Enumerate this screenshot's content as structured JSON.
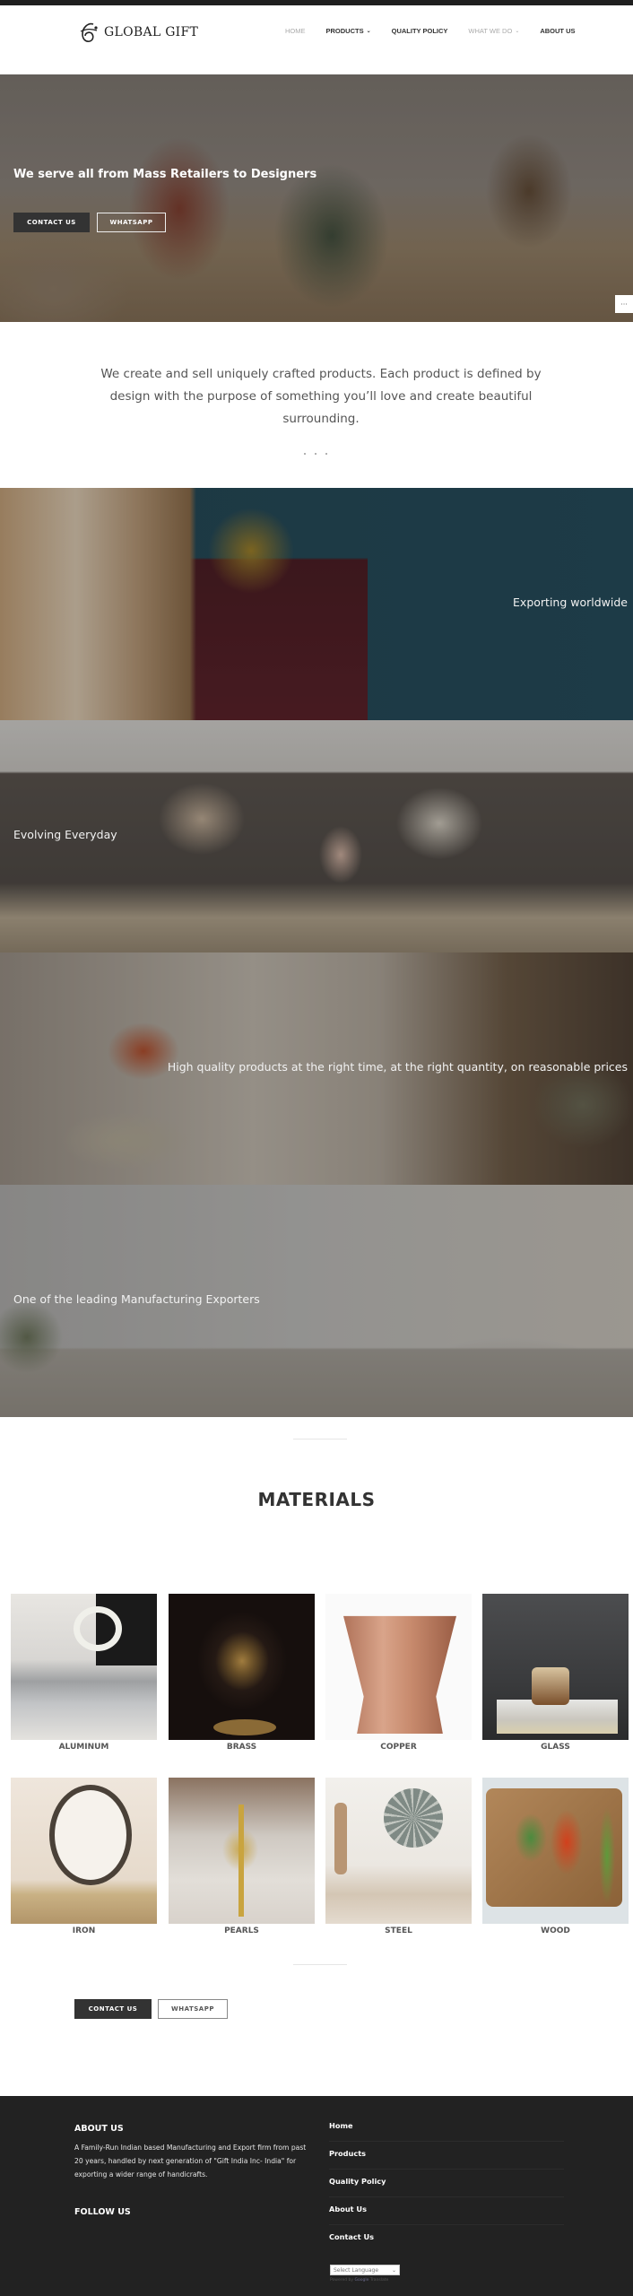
{
  "header": {
    "logo_text": "GLOBAL GIFT",
    "nav": [
      {
        "label": "HOME",
        "dropdown": false,
        "muted": true
      },
      {
        "label": "PRODUCTS",
        "dropdown": true,
        "muted": false
      },
      {
        "label": "QUALITY POLICY",
        "dropdown": false,
        "muted": false
      },
      {
        "label": "WHAT WE DO",
        "dropdown": true,
        "muted": true
      },
      {
        "label": "ABOUT US",
        "dropdown": false,
        "muted": false
      }
    ]
  },
  "hero": {
    "title": "We serve all from Mass Retailers to Designers",
    "contact_label": "CONTACT US",
    "whatsapp_label": "WHATSAPP",
    "more_label": "···"
  },
  "intro": {
    "text": "We create and sell uniquely crafted products. Each product is defined by design with the purpose of something you’ll love and create beautiful surrounding."
  },
  "banners": [
    {
      "text": "Exporting worldwide",
      "align": "right"
    },
    {
      "text": "Evolving Everyday",
      "align": "left"
    },
    {
      "text": "High quality products at the right time, at the right quantity, on reasonable prices",
      "align": "right"
    },
    {
      "text": "One of the leading Manufacturing Exporters",
      "align": "left"
    }
  ],
  "materials": {
    "title": "MATERIALS",
    "items": [
      {
        "label": "ALUMINUM"
      },
      {
        "label": "BRASS"
      },
      {
        "label": "COPPER"
      },
      {
        "label": "GLASS"
      },
      {
        "label": "IRON"
      },
      {
        "label": "PEARLS"
      },
      {
        "label": "STEEL"
      },
      {
        "label": "WOOD"
      }
    ]
  },
  "cta": {
    "contact_label": "CONTACT US",
    "whatsapp_label": "WHATSAPP"
  },
  "footer": {
    "about_heading": "ABOUT US",
    "about_text": "A Family-Run Indian based Manufacturing and Export firm from past 20 years, handled by next generation of \"Gift India Inc- India\" for exporting a wider range of handicrafts.",
    "follow_heading": "FOLLOW US",
    "links": [
      "Home",
      "Products",
      "Quality Policy",
      "About Us",
      "Contact Us"
    ],
    "language_select": "Select Language",
    "powered_prefix": "Powered by",
    "powered_brand": "Google",
    "powered_suffix": "Translate"
  },
  "colors": {
    "dark": "#333333",
    "footer_bg": "#222222",
    "topbar": "#1f1f1f"
  }
}
